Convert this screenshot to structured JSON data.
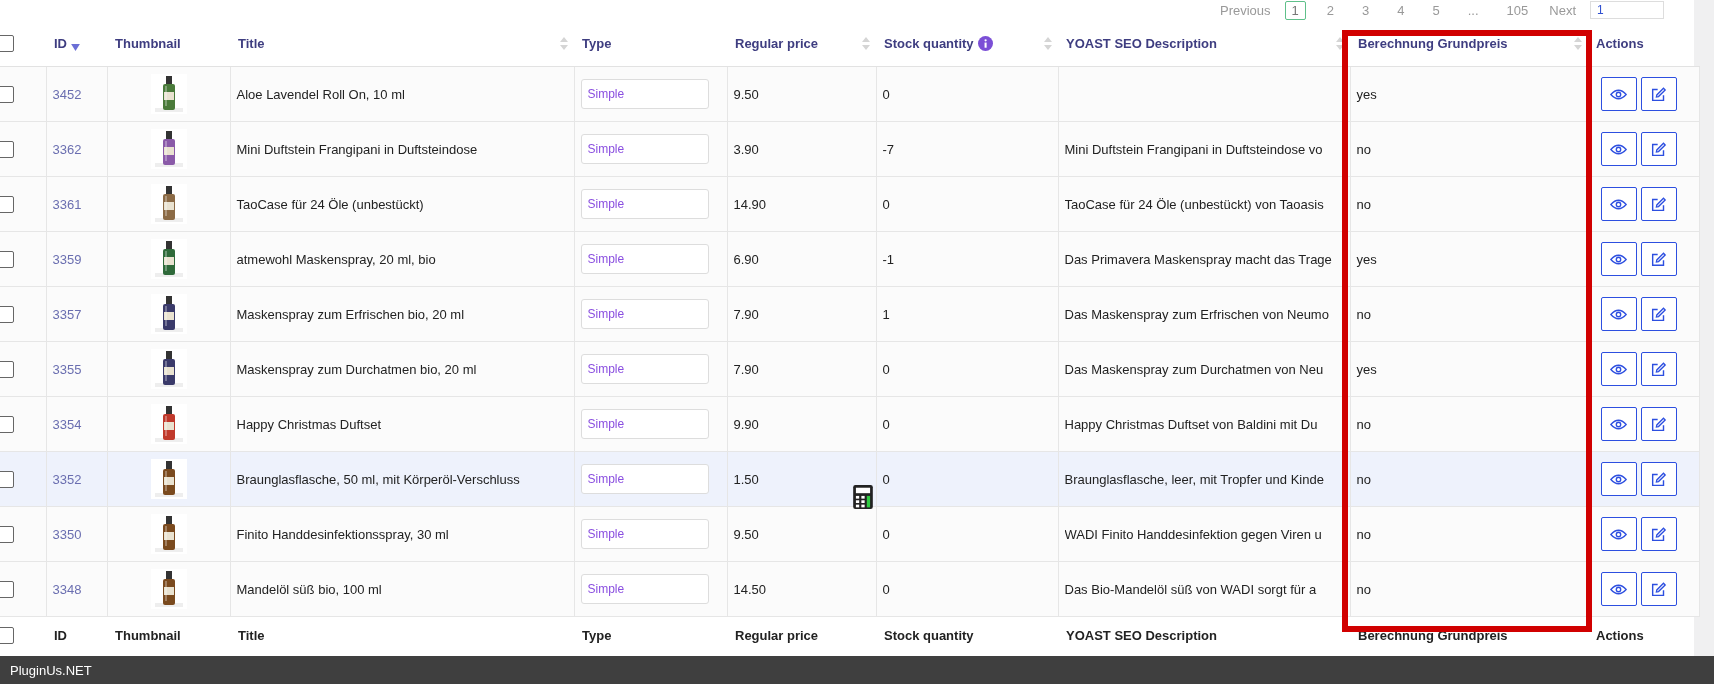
{
  "pagination": {
    "previous": "Previous",
    "pages": [
      {
        "label": "1",
        "selected": true
      },
      {
        "label": "2",
        "selected": false
      },
      {
        "label": "3",
        "selected": false
      },
      {
        "label": "4",
        "selected": false
      },
      {
        "label": "5",
        "selected": false
      },
      {
        "label": "...",
        "selected": false
      },
      {
        "label": "105",
        "selected": false
      }
    ],
    "next": "Next",
    "page_input": "1"
  },
  "columns": [
    {
      "label": "ID",
      "sortable": true,
      "sorted": true,
      "info": false
    },
    {
      "label": "Thumbnail",
      "sortable": false,
      "sorted": false,
      "info": false
    },
    {
      "label": "Title",
      "sortable": true,
      "sorted": false,
      "info": false
    },
    {
      "label": "Type",
      "sortable": false,
      "sorted": false,
      "info": false
    },
    {
      "label": "Regular price",
      "sortable": true,
      "sorted": false,
      "info": false
    },
    {
      "label": "Stock quantity",
      "sortable": true,
      "sorted": false,
      "info": true
    },
    {
      "label": "YOAST SEO Description",
      "sortable": true,
      "sorted": false,
      "info": false
    },
    {
      "label": "Berechnung Grundpreis",
      "sortable": true,
      "sorted": false,
      "info": false
    },
    {
      "label": "Actions",
      "sortable": false,
      "sorted": false,
      "info": false
    }
  ],
  "rows": [
    {
      "checked": false,
      "hovered": false,
      "id": "3452",
      "title": "Aloe Lavendel Roll On, 10 ml",
      "type": "Simple",
      "price": "9.50",
      "stock": "0",
      "seo": "",
      "grundpreis": "yes"
    },
    {
      "checked": false,
      "hovered": false,
      "id": "3362",
      "title": "Mini Duftstein Frangipani in Duftsteindose",
      "type": "Simple",
      "price": "3.90",
      "stock": "-7",
      "seo": "Mini Duftstein Frangipani in Duftsteindose vo",
      "grundpreis": "no"
    },
    {
      "checked": false,
      "hovered": false,
      "id": "3361",
      "title": "TaoCase für 24 Öle (unbestückt)",
      "type": "Simple",
      "price": "14.90",
      "stock": "0",
      "seo": "TaoCase für 24 Öle (unbestückt) von Taoasis",
      "grundpreis": "no"
    },
    {
      "checked": false,
      "hovered": false,
      "id": "3359",
      "title": "atmewohl Maskenspray, 20 ml, bio",
      "type": "Simple",
      "price": "6.90",
      "stock": "-1",
      "seo": "Das Primavera Maskenspray macht das Trage",
      "grundpreis": "yes"
    },
    {
      "checked": false,
      "hovered": false,
      "id": "3357",
      "title": "Maskenspray zum Erfrischen bio, 20 ml",
      "type": "Simple",
      "price": "7.90",
      "stock": "1",
      "seo": "Das Maskenspray zum Erfrischen von Neumo",
      "grundpreis": "no"
    },
    {
      "checked": false,
      "hovered": false,
      "id": "3355",
      "title": "Maskenspray zum Durchatmen bio, 20 ml",
      "type": "Simple",
      "price": "7.90",
      "stock": "0",
      "seo": "Das Maskenspray zum Durchatmen von Neu",
      "grundpreis": "yes"
    },
    {
      "checked": false,
      "hovered": false,
      "id": "3354",
      "title": "Happy Christmas Duftset",
      "type": "Simple",
      "price": "9.90",
      "stock": "0",
      "seo": "Happy Christmas Duftset von Baldini mit Du",
      "grundpreis": "no"
    },
    {
      "checked": false,
      "hovered": true,
      "id": "3352",
      "title": "Braunglasflasche, 50 ml, mit Körperöl-Verschluss",
      "type": "Simple",
      "price": "1.50",
      "stock": "0",
      "seo": "Braunglasflasche, leer, mit Tropfer und Kinde",
      "grundpreis": "no"
    },
    {
      "checked": false,
      "hovered": false,
      "id": "3350",
      "title": "Finito Handdesinfektionsspray, 30 ml",
      "type": "Simple",
      "price": "9.50",
      "stock": "0",
      "seo": "WADI Finito Handdesinfektion gegen Viren u",
      "grundpreis": "no"
    },
    {
      "checked": false,
      "hovered": false,
      "id": "3348",
      "title": "Mandelöl süß bio, 100 ml",
      "type": "Simple",
      "price": "14.50",
      "stock": "0",
      "seo": "Das Bio-Mandelöl süß von WADI sorgt für a",
      "grundpreis": "no"
    }
  ],
  "footer_columns": [
    "ID",
    "Thumbnail",
    "Title",
    "Type",
    "Regular price",
    "Stock quantity",
    "YOAST SEO Description",
    "Berechnung Grundpreis",
    "Actions"
  ],
  "footer_checked": false,
  "header_checked": false,
  "status_bar": {
    "text": "PluginUs.NET"
  }
}
